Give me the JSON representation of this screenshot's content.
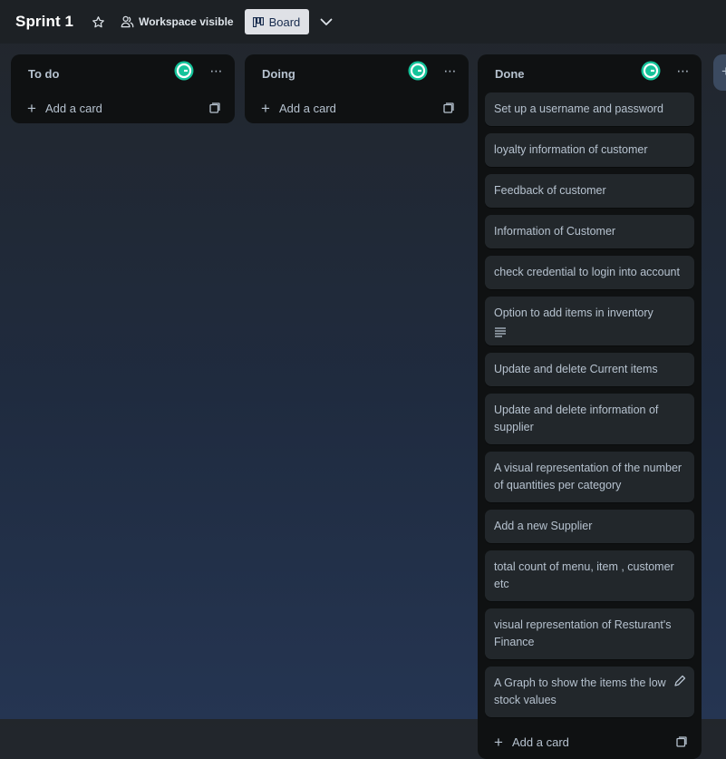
{
  "header": {
    "board_title": "Sprint 1",
    "visibility_label": "Workspace visible",
    "view_label": "Board"
  },
  "lists": [
    {
      "title": "To do",
      "add_card_label": "Add a card",
      "cards": []
    },
    {
      "title": "Doing",
      "add_card_label": "Add a card",
      "cards": []
    },
    {
      "title": "Done",
      "add_card_label": "Add a card",
      "cards": [
        "Set up a username and password",
        "loyalty information of customer",
        "Feedback of customer",
        "Information of Customer",
        "check credential to login into account",
        "Option to add items in inventory",
        "Update and delete Current items",
        "Update and delete information of supplier",
        "A visual representation of the number of quantities per category",
        "Add a new Supplier",
        "total count of menu, item , customer etc",
        "visual representation of Resturant's Finance",
        "A Graph to show the items the low stock values"
      ]
    }
  ],
  "colors": {
    "header_bg": "#1d2125",
    "list_bg": "#0f1112",
    "card_bg": "#22272b",
    "grammarly_green": "#15c39a",
    "view_button_bg": "#dfe1e6"
  }
}
